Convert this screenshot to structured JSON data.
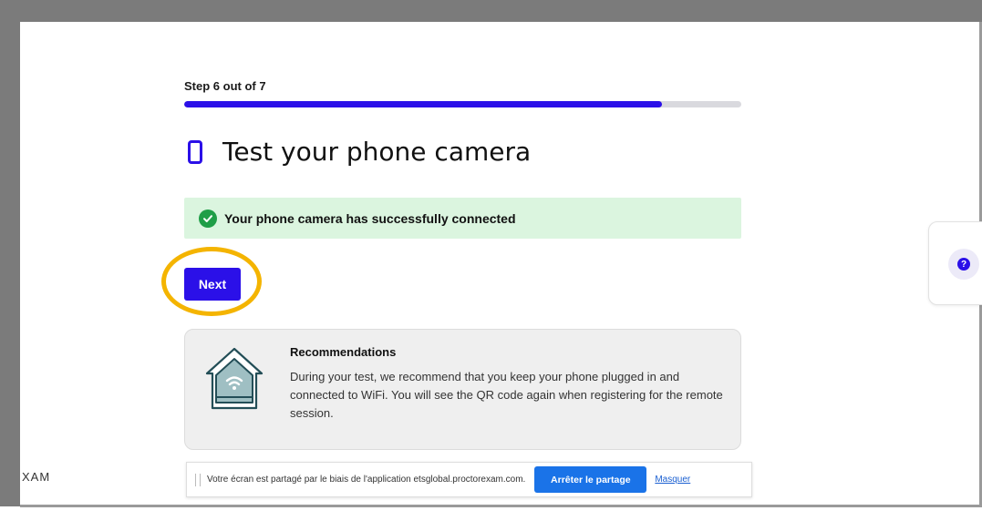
{
  "progress": {
    "step_label": "Step 6 out of 7",
    "fraction": 0.857
  },
  "header": {
    "title": "Test your phone camera",
    "icon": "phone-icon"
  },
  "banner": {
    "text": "Your phone camera has successfully connected",
    "icon": "check-circle-icon"
  },
  "actions": {
    "next_label": "Next"
  },
  "recommendations": {
    "title": "Recommendations",
    "body": "During your test, we recommend that you keep your phone plugged in and connected to WiFi. You will see the QR code again when registering for the remote session.",
    "icon": "house-wifi-icon"
  },
  "help": {
    "icon": "help-icon"
  },
  "brand": {
    "text": "XAM"
  },
  "share_bar": {
    "text": "Votre écran est partagé par le biais de l'application etsglobal.proctorexam.com.",
    "stop_label": "Arrêter le partage",
    "hide_label": "Masquer"
  },
  "colors": {
    "accent": "#2b10e8",
    "success_bg": "#dbf5df",
    "success_icon": "#1f9e47",
    "highlight": "#f4b400",
    "share_button": "#1a73e8"
  }
}
